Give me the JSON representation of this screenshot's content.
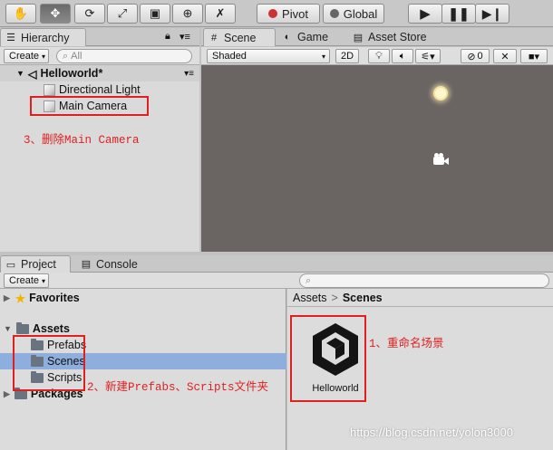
{
  "toolbar": {
    "tools": [
      "hand-tool",
      "move-tool",
      "rotate-tool",
      "scale-tool",
      "rect-tool",
      "transform-tool",
      "custom-tool"
    ],
    "pivot_label": "Pivot",
    "global_label": "Global",
    "play": "play",
    "pause": "pause",
    "step": "step"
  },
  "hierarchy": {
    "tab_label": "Hierarchy",
    "create_label": "Create",
    "search_placeholder": "All",
    "scene_name": "Helloworld*",
    "items": [
      "Directional Light",
      "Main Camera"
    ]
  },
  "scene_tabs": {
    "scene": "Scene",
    "game": "Game",
    "asset_store": "Asset Store"
  },
  "scene_toolbar": {
    "shading": "Shaded",
    "mode_2d": "2D",
    "gizmo_count": "0"
  },
  "project": {
    "tab_project": "Project",
    "tab_console": "Console",
    "create_label": "Create",
    "favorites": "Favorites",
    "assets": "Assets",
    "folders": [
      "Prefabs",
      "Scenes",
      "Scripts"
    ],
    "packages": "Packages",
    "breadcrumb_root": "Assets",
    "breadcrumb_current": "Scenes",
    "asset_item": "Helloworld"
  },
  "annotations": {
    "step1": "1、重命名场景",
    "step2": "2、新建Prefabs、Scripts文件夹",
    "step3": "3、删除Main Camera"
  },
  "watermark": "https://blog.csdn.net/yolon3000",
  "colors": {
    "selection": "#8eaede",
    "annotation": "#e02020",
    "scene_bg": "#6a6463"
  }
}
